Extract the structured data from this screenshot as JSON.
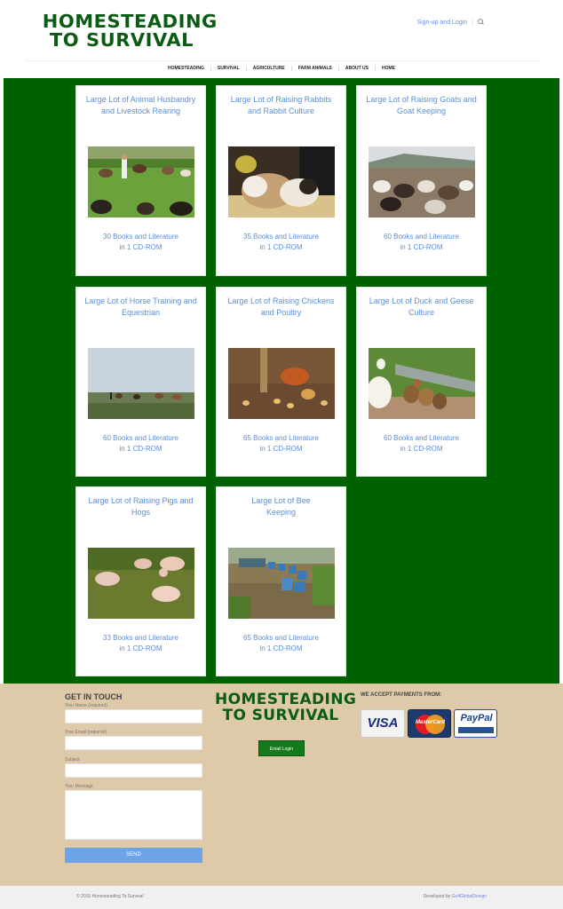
{
  "header": {
    "logo_line1": "HOMESTEADING",
    "logo_line2": "TO SURVIVAL",
    "signup_link": "Sign-up and Login",
    "search_icon": "search-icon"
  },
  "nav": [
    "HOMESTEADING",
    "SURVIVAL",
    "AGRICULTURE",
    "FARM ANIMALS",
    "ABOUT US",
    "HOME"
  ],
  "products": [
    {
      "title": "Large Lot of Animal Husbandry and Livestock Rearing",
      "count_line1": "30 Books and Literature",
      "count_line2": "in 1 CD-ROM"
    },
    {
      "title": "Large Lot of Raising Rabbits and Rabbit Culture",
      "count_line1": "35 Books and Literature",
      "count_line2": "in 1 CD-ROM"
    },
    {
      "title": "Large Lot of Raising Goats and Goat Keeping",
      "count_line1": "60 Books and Literature",
      "count_line2": "in 1 CD-ROM"
    },
    {
      "title": "Large Lot of Horse Training and Equestrian",
      "count_line1": "60 Books and Literature",
      "count_line2": "in 1 CD-ROM"
    },
    {
      "title": "Large Lot of Raising Chickens and Poultry",
      "count_line1": "65 Books and Literature",
      "count_line2": "in 1 CD-ROM"
    },
    {
      "title": "Large Lot of Duck and Geese Culture",
      "count_line1": "60 Books and Literature",
      "count_line2": "in 1 CD-ROM"
    },
    {
      "title": "Large Lot of Raising Pigs and Hogs",
      "count_line1": "33 Books and Literature",
      "count_line2": "in 1 CD-ROM"
    },
    {
      "title": "Large Lot of Bee Keeping",
      "count_line1": "65 Books and Literature",
      "count_line2": "in 1 CD-ROM"
    }
  ],
  "footer": {
    "contact_heading": "GET IN TOUCH",
    "name_label": "Your Name (required)",
    "email_label": "Your Email (required)",
    "subject_label": "Subject",
    "message_label": "Your Message",
    "send_label": "SEND",
    "logo_line1": "HOMESTEADING",
    "logo_line2": "TO SURVIVAL",
    "email_login_label": "Email Login",
    "payments_heading": "WE ACCEPT PAYMENTS FROM:",
    "payments": [
      "VISA",
      "MasterCard",
      "PayPal"
    ]
  },
  "bottom_bar": {
    "copyright": "© 2016 Homesteading To Survival",
    "developed_by": "Developed by",
    "developer": "Go4GlobalDesign"
  },
  "colors": {
    "brand_green": "#006100",
    "link_blue": "#5a8ed6",
    "footer_bg": "#decaa8",
    "send_button": "#6da4e8"
  }
}
